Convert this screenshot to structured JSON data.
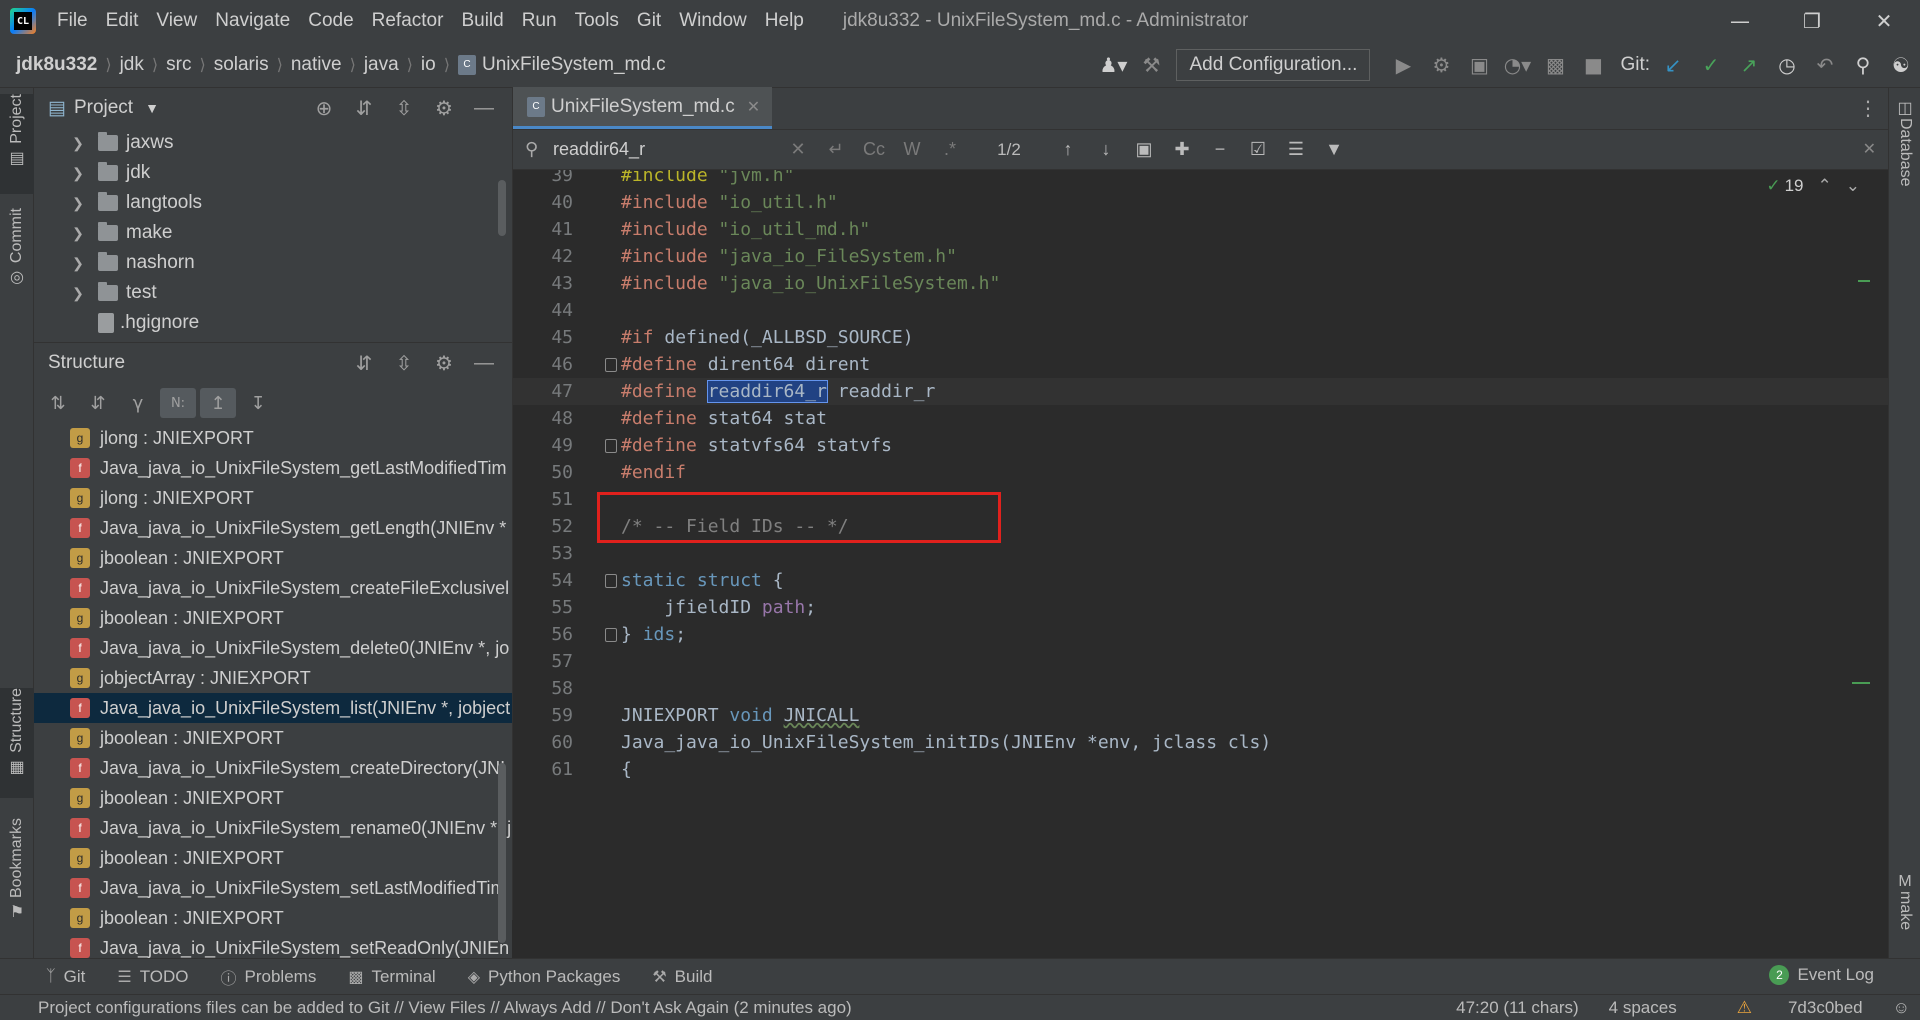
{
  "window": {
    "title": "jdk8u332 - UnixFileSystem_md.c - Administrator",
    "app_icon_text": "CL"
  },
  "menu": [
    "File",
    "Edit",
    "View",
    "Navigate",
    "Code",
    "Refactor",
    "Build",
    "Run",
    "Tools",
    "Git",
    "Window",
    "Help"
  ],
  "breadcrumbs": [
    "jdk8u332",
    "jdk",
    "src",
    "solaris",
    "native",
    "java",
    "io",
    "UnixFileSystem_md.c"
  ],
  "toolbar": {
    "add_configuration": "Add Configuration...",
    "git_label": "Git:"
  },
  "left_strip": {
    "project": "Project",
    "commit": "Commit",
    "structure": "Structure",
    "bookmarks": "Bookmarks"
  },
  "right_strip": {
    "database": "Database",
    "make": "make"
  },
  "project_panel": {
    "title": "Project",
    "items": [
      {
        "label": "jaxws",
        "type": "folder"
      },
      {
        "label": "jdk",
        "type": "folder"
      },
      {
        "label": "langtools",
        "type": "folder"
      },
      {
        "label": "make",
        "type": "folder"
      },
      {
        "label": "nashorn",
        "type": "folder"
      },
      {
        "label": "test",
        "type": "folder"
      },
      {
        "label": ".hgignore",
        "type": "file"
      }
    ]
  },
  "structure_panel": {
    "title": "Structure",
    "items": [
      {
        "kind": "g",
        "label": "jlong : JNIEXPORT"
      },
      {
        "kind": "f",
        "label": "Java_java_io_UnixFileSystem_getLastModifiedTim"
      },
      {
        "kind": "g",
        "label": "jlong : JNIEXPORT"
      },
      {
        "kind": "f",
        "label": "Java_java_io_UnixFileSystem_getLength(JNIEnv *"
      },
      {
        "kind": "g",
        "label": "jboolean : JNIEXPORT"
      },
      {
        "kind": "f",
        "label": "Java_java_io_UnixFileSystem_createFileExclusivel"
      },
      {
        "kind": "g",
        "label": "jboolean : JNIEXPORT"
      },
      {
        "kind": "f",
        "label": "Java_java_io_UnixFileSystem_delete0(JNIEnv *, jo"
      },
      {
        "kind": "g",
        "label": "jobjectArray : JNIEXPORT"
      },
      {
        "kind": "f",
        "label": "Java_java_io_UnixFileSystem_list(JNIEnv *, jobject"
      },
      {
        "kind": "g",
        "label": "jboolean : JNIEXPORT"
      },
      {
        "kind": "f",
        "label": "Java_java_io_UnixFileSystem_createDirectory(JNI"
      },
      {
        "kind": "g",
        "label": "jboolean : JNIEXPORT"
      },
      {
        "kind": "f",
        "label": "Java_java_io_UnixFileSystem_rename0(JNIEnv *, j"
      },
      {
        "kind": "g",
        "label": "jboolean : JNIEXPORT"
      },
      {
        "kind": "f",
        "label": "Java_java_io_UnixFileSystem_setLastModifiedTim"
      },
      {
        "kind": "g",
        "label": "jboolean : JNIEXPORT"
      },
      {
        "kind": "f",
        "label": "Java_java_io_UnixFileSystem_setReadOnly(JNIEn"
      }
    ]
  },
  "editor": {
    "tab_label": "UnixFileSystem_md.c",
    "find": {
      "query": "readdir64_r",
      "count": "1/2",
      "match_case": "Cc",
      "words": "W",
      "regex": ".*"
    },
    "inspections": {
      "count": "19"
    },
    "lines": [
      {
        "n": "39",
        "parts": [
          [
            "pp",
            "#include "
          ],
          [
            "str",
            "\"jvm.h\""
          ]
        ]
      },
      {
        "n": "40",
        "parts": [
          [
            "pp2",
            "#include "
          ],
          [
            "str",
            "\"io_util.h\""
          ]
        ]
      },
      {
        "n": "41",
        "parts": [
          [
            "pp2",
            "#include "
          ],
          [
            "str",
            "\"io_util_md.h\""
          ]
        ]
      },
      {
        "n": "42",
        "parts": [
          [
            "pp2",
            "#include "
          ],
          [
            "str",
            "\"java_io_FileSystem.h\""
          ]
        ]
      },
      {
        "n": "43",
        "parts": [
          [
            "pp2",
            "#include "
          ],
          [
            "str",
            "\"java_io_UnixFileSystem.h\""
          ]
        ]
      },
      {
        "n": "44",
        "parts": []
      },
      {
        "n": "45",
        "parts": [
          [
            "pp2",
            "#if "
          ],
          [
            "plain",
            "defined(_ALLBSD_SOURCE)"
          ]
        ]
      },
      {
        "n": "46",
        "parts": [
          [
            "pp2",
            "#define "
          ],
          [
            "plain",
            "dirent64 dirent"
          ]
        ]
      },
      {
        "n": "47",
        "parts": [
          [
            "pp2",
            "#define "
          ],
          [
            "match",
            "readdir64_r"
          ],
          [
            "plain",
            " readdir_r"
          ]
        ]
      },
      {
        "n": "48",
        "parts": [
          [
            "pp2",
            "#define "
          ],
          [
            "plain",
            "stat64 stat"
          ]
        ]
      },
      {
        "n": "49",
        "parts": [
          [
            "pp2",
            "#define "
          ],
          [
            "plain",
            "statvfs64 statvfs"
          ]
        ]
      },
      {
        "n": "50",
        "parts": [
          [
            "pp2",
            "#endif"
          ]
        ]
      },
      {
        "n": "51",
        "parts": []
      },
      {
        "n": "52",
        "parts": [
          [
            "cm",
            "/* -- Field IDs -- */"
          ]
        ]
      },
      {
        "n": "53",
        "parts": []
      },
      {
        "n": "54",
        "parts": [
          [
            "blue",
            "static struct "
          ],
          [
            "plain",
            "{"
          ]
        ]
      },
      {
        "n": "55",
        "parts": [
          [
            "plain",
            "    jfieldID "
          ],
          [
            "field",
            "path"
          ],
          [
            "plain",
            ";"
          ]
        ]
      },
      {
        "n": "56",
        "parts": [
          [
            "plain",
            "} "
          ],
          [
            "blue",
            "ids"
          ],
          [
            "plain",
            ";"
          ]
        ]
      },
      {
        "n": "57",
        "parts": []
      },
      {
        "n": "58",
        "parts": []
      },
      {
        "n": "59",
        "parts": [
          [
            "plain",
            "JNIEXPORT "
          ],
          [
            "blue",
            "void "
          ],
          [
            "wavy",
            "JNICALL"
          ]
        ]
      },
      {
        "n": "60",
        "parts": [
          [
            "plain",
            "Java_java_io_UnixFileSystem_initIDs(JNIEnv *env, jclass cls)"
          ]
        ]
      },
      {
        "n": "61",
        "parts": [
          [
            "plain",
            "{"
          ]
        ]
      }
    ]
  },
  "bottom_tools": [
    "Git",
    "TODO",
    "Problems",
    "Terminal",
    "Python Packages",
    "Build"
  ],
  "event_log": {
    "label": "Event Log",
    "count": "2"
  },
  "status": {
    "message": "Project configurations files can be added to Git // View Files // Always Add // Don't Ask Again (2 minutes ago)",
    "position": "47:20 (11 chars)",
    "indent": "4 spaces",
    "branch": "7d3c0bed"
  }
}
